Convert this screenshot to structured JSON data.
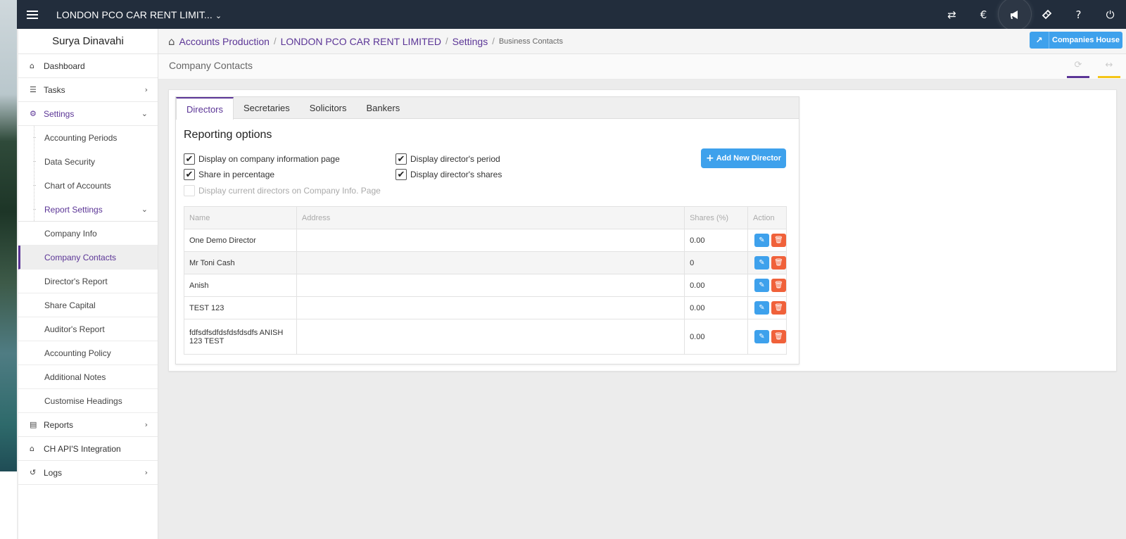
{
  "topbar": {
    "company": "LONDON PCO CAR RENT LIMIT...",
    "icons": [
      "transfer-icon",
      "currency-icon",
      "megaphone-icon",
      "ticket-icon",
      "help-icon",
      "power-icon"
    ],
    "icon_glyphs": [
      "⇄",
      "€",
      "📢",
      "🎫",
      "?",
      "⏻"
    ]
  },
  "sidebar": {
    "user": "Surya Dinavahi",
    "dashboard": "Dashboard",
    "tasks": "Tasks",
    "settings": "Settings",
    "settings_items": [
      "Accounting Periods",
      "Data Security",
      "Chart of Accounts"
    ],
    "report_settings": "Report Settings",
    "report_items": [
      "Company Info",
      "Company Contacts",
      "Director's Report",
      "Share Capital",
      "Auditor's Report",
      "Accounting Policy",
      "Additional Notes",
      "Customise Headings"
    ],
    "reports": "Reports",
    "ch_api": "CH API'S Integration",
    "logs": "Logs"
  },
  "breadcrumb": {
    "items": [
      "Accounts Production",
      "LONDON PCO CAR RENT LIMITED",
      "Settings"
    ],
    "current": "Business Contacts",
    "companies_house": "Companies House"
  },
  "page": {
    "title": "Company Contacts"
  },
  "tabs": [
    "Directors",
    "Secretaries",
    "Solicitors",
    "Bankers"
  ],
  "reporting": {
    "title": "Reporting options",
    "options": [
      {
        "label": "Display on company information page",
        "checked": "✔"
      },
      {
        "label": "Share in percentage",
        "checked": "✔"
      },
      {
        "label": "Display current directors on Company Info. Page",
        "checked": ""
      },
      {
        "label": "Display director's period",
        "checked": "✔"
      },
      {
        "label": "Display director's shares",
        "checked": "✔"
      }
    ],
    "add_button": "Add New Director"
  },
  "table": {
    "headers": [
      "Name",
      "Address",
      "Shares (%)",
      "Action"
    ],
    "rows": [
      {
        "name": "One Demo Director",
        "address": "",
        "shares": "0.00"
      },
      {
        "name": "Mr Toni Cash",
        "address": "",
        "shares": "0"
      },
      {
        "name": "Anish",
        "address": "",
        "shares": "0.00"
      },
      {
        "name": "TEST 123",
        "address": "",
        "shares": "0.00"
      },
      {
        "name": "fdfsdfsdfdsfdsfdsdfs ANISH 123 TEST",
        "address": "",
        "shares": "0.00"
      }
    ]
  },
  "colors": {
    "topbar": "#222d3c",
    "accent_purple": "#5b3596",
    "button_blue": "#3ea1ec",
    "delete_orange": "#f0613a",
    "tool_bar_purple": "#5b3596",
    "tool_bar_yellow": "#f5c518"
  }
}
